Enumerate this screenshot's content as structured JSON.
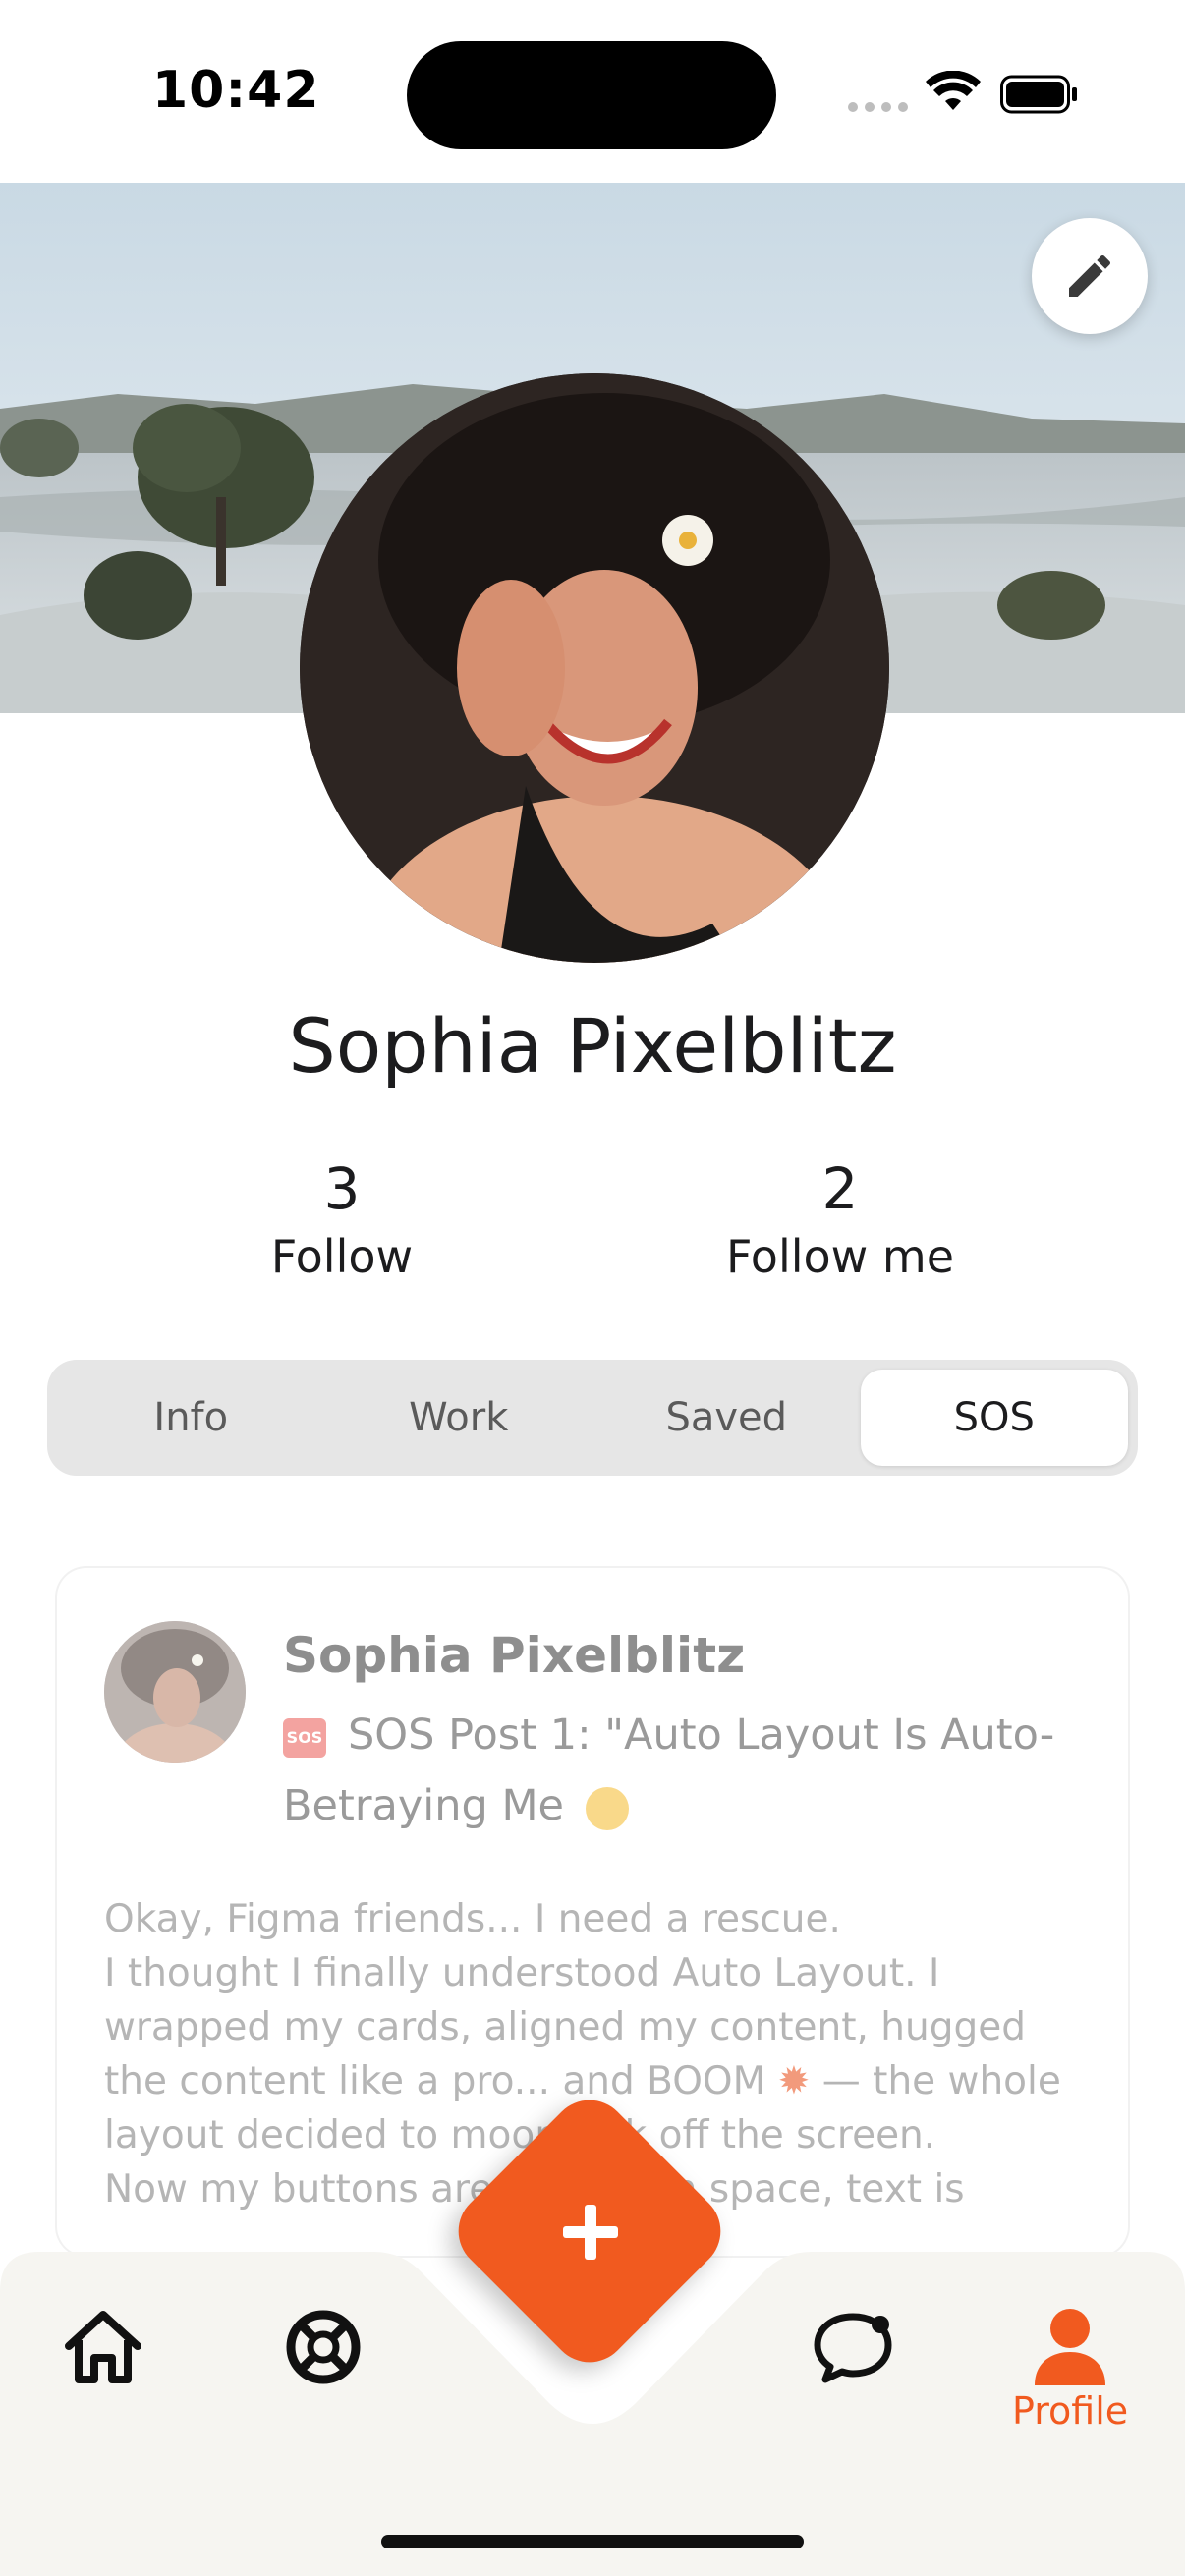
{
  "status_bar": {
    "time": "10:42"
  },
  "profile": {
    "name": "Sophia Pixelblitz",
    "stats": [
      {
        "value": "3",
        "label": "Follow"
      },
      {
        "value": "2",
        "label": "Follow me"
      }
    ]
  },
  "tabs": [
    {
      "label": "Info",
      "active": false
    },
    {
      "label": "Work",
      "active": false
    },
    {
      "label": "Saved",
      "active": false
    },
    {
      "label": "SOS",
      "active": true
    }
  ],
  "post": {
    "author": "Sophia Pixelblitz",
    "badge": "SOS",
    "title_line1": "SOS Post 1: \"Auto Layout Is Auto-",
    "title_line2": "Betraying Me",
    "body_lines": [
      "Okay, Figma friends... I need a rescue.",
      "I thought I finally understood Auto Layout. I",
      "wrapped my cards, aligned my content, hugged",
      "the content like a pro... and BOOM",
      "— the whole",
      "layout decided to moonwalk off the screen.",
      "Now my buttons are floating in space, text is"
    ]
  },
  "nav": {
    "items": [
      {
        "icon": "home-icon"
      },
      {
        "icon": "lifebuoy-icon"
      },
      {
        "icon": "chat-bubble-icon"
      },
      {
        "icon": "person-icon",
        "label": "Profile"
      }
    ],
    "fab_icon": "plus-icon"
  },
  "colors": {
    "accent": "#f15a1f"
  }
}
